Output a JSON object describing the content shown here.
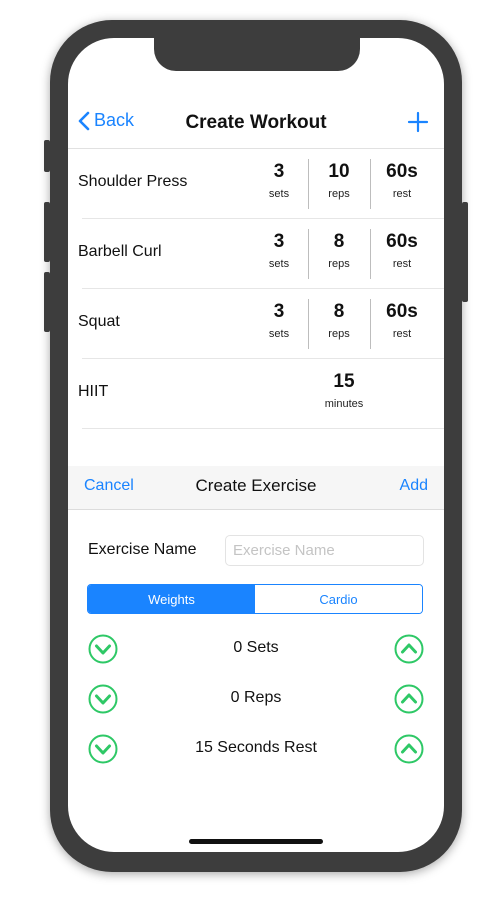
{
  "navbar": {
    "back_label": "Back",
    "title": "Create Workout"
  },
  "workout_list": [
    {
      "name": "Shoulder Press",
      "sets": "3",
      "sets_label": "sets",
      "reps": "10",
      "reps_label": "reps",
      "rest": "60s",
      "rest_label": "rest"
    },
    {
      "name": "Barbell Curl",
      "sets": "3",
      "sets_label": "sets",
      "reps": "8",
      "reps_label": "reps",
      "rest": "60s",
      "rest_label": "rest"
    },
    {
      "name": "Squat",
      "sets": "3",
      "sets_label": "sets",
      "reps": "8",
      "reps_label": "reps",
      "rest": "60s",
      "rest_label": "rest"
    },
    {
      "name": "HIIT",
      "duration": "15",
      "duration_label": "minutes"
    }
  ],
  "sheet": {
    "cancel_label": "Cancel",
    "title": "Create Exercise",
    "add_label": "Add",
    "exercise_name_label": "Exercise Name",
    "exercise_name_value": "",
    "exercise_name_placeholder": "Exercise Name",
    "segments": [
      "Weights",
      "Cardio"
    ],
    "selected_segment": "Weights",
    "steppers": [
      {
        "label": "0 Sets"
      },
      {
        "label": "0 Reps"
      },
      {
        "label": "15 Seconds Rest"
      }
    ]
  },
  "icons": {
    "back": "chevron-left-icon",
    "add": "plus-icon",
    "decrement": "chevron-down-circle-icon",
    "increment": "chevron-up-circle-icon"
  },
  "colors": {
    "accent": "#1a84ff",
    "stepper": "#2ec866",
    "device_frame": "#3d3d3d"
  }
}
